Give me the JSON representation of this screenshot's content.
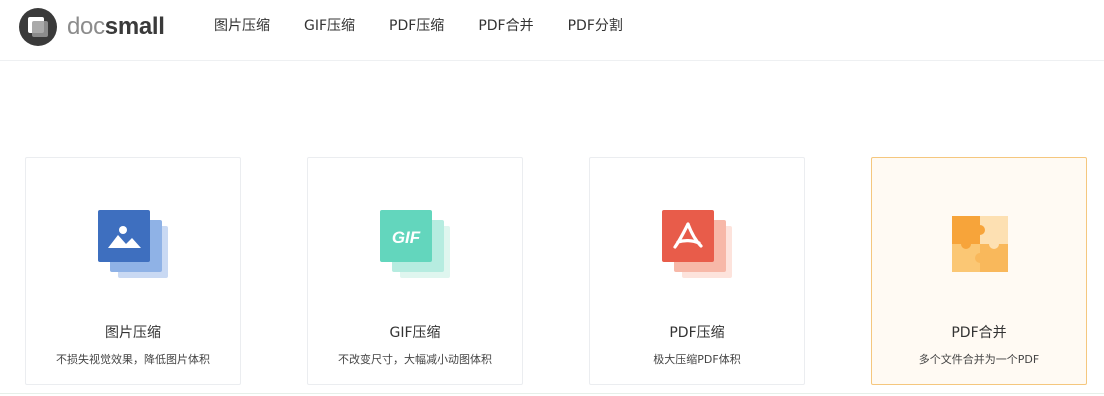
{
  "brand": {
    "part1": "doc",
    "part2": "small"
  },
  "nav": [
    {
      "label": "图片压缩"
    },
    {
      "label": "GIF压缩"
    },
    {
      "label": "PDF压缩"
    },
    {
      "label": "PDF合并"
    },
    {
      "label": "PDF分割"
    }
  ],
  "cards": [
    {
      "title": "图片压缩",
      "desc": "不损失视觉效果，降低图片体积",
      "icon": "image-icon",
      "color": "#3e6fbf"
    },
    {
      "title": "GIF压缩",
      "desc": "不改变尺寸，大幅减小动图体积",
      "icon": "gif-icon",
      "color": "#63d6bd",
      "icon_text": "GIF"
    },
    {
      "title": "PDF压缩",
      "desc": "极大压缩PDF体积",
      "icon": "pdf-icon",
      "color": "#e85c4a"
    },
    {
      "title": "PDF合并",
      "desc": "多个文件合并为一个PDF",
      "icon": "puzzle-icon",
      "color": "#f7a43a",
      "active": true
    }
  ]
}
